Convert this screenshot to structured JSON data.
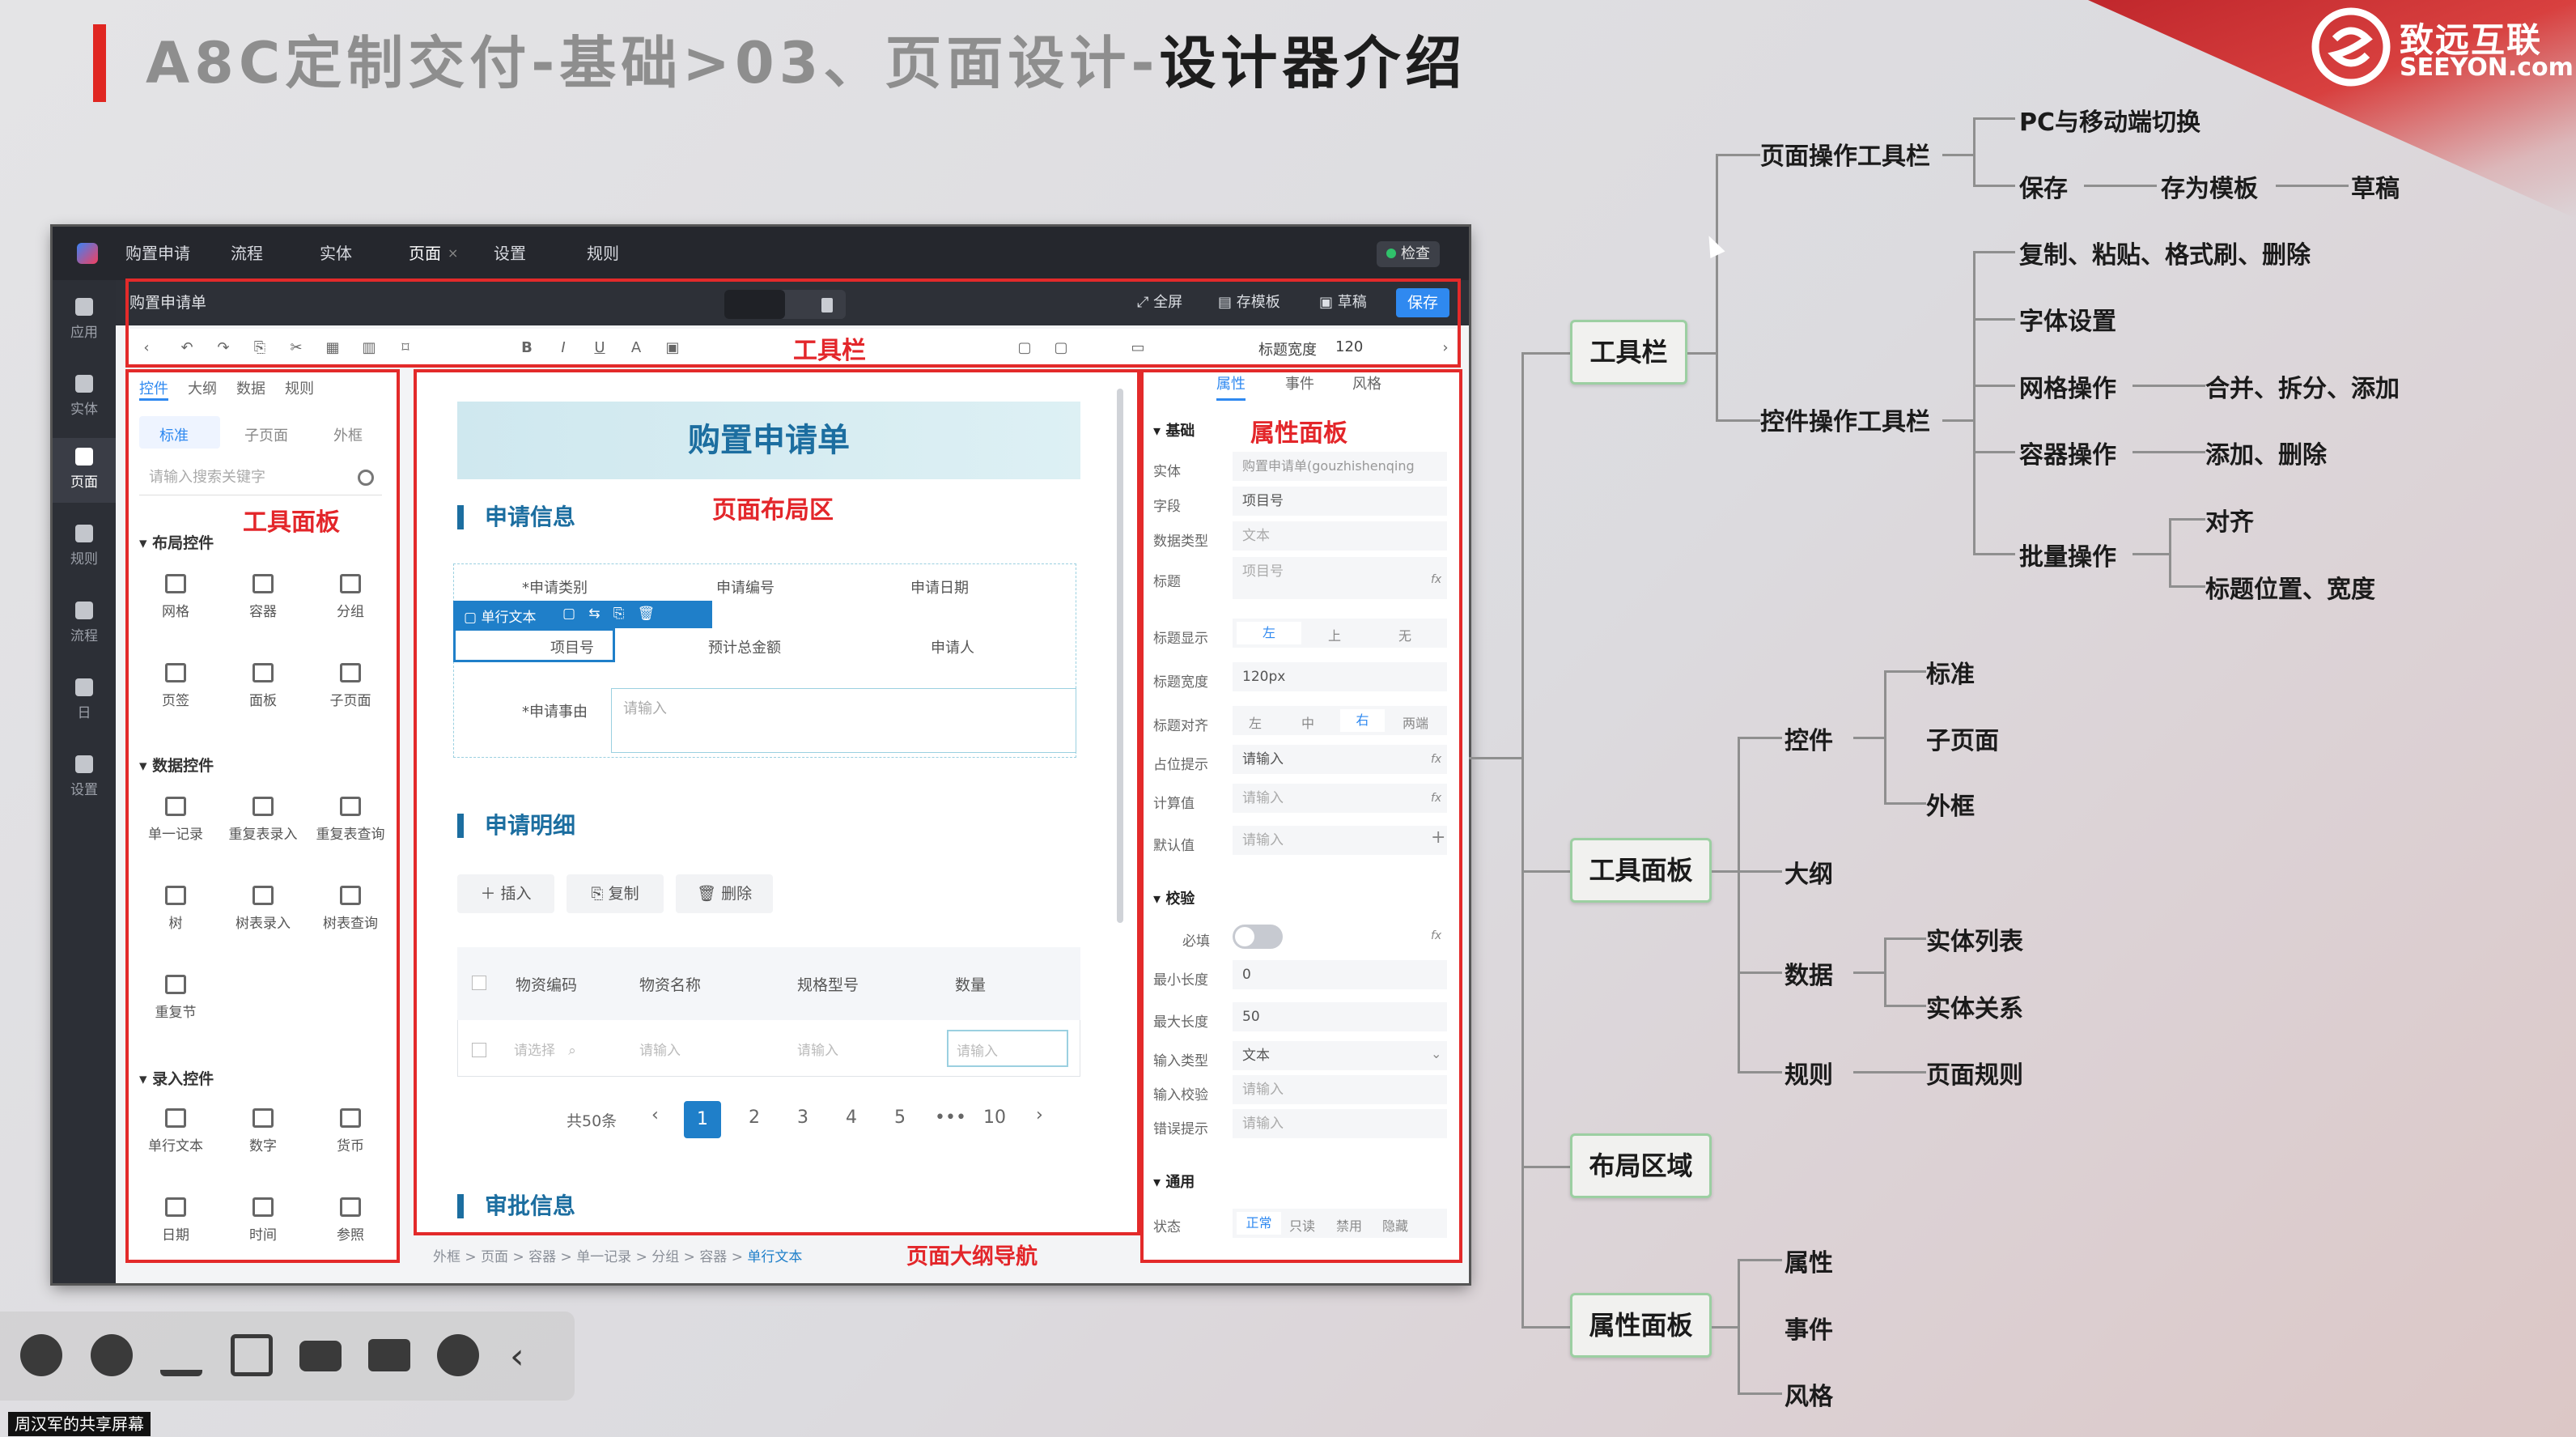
{
  "title": {
    "prefix": "A8C定制交付-基础>03、页面设计-",
    "emphasis": "设计器介绍"
  },
  "logo": {
    "name": "致远互联",
    "sub": "SEEYON.com"
  },
  "app": {
    "tabs": [
      "购置申请",
      "流程",
      "实体",
      "页面",
      "设置",
      "规则"
    ],
    "tab_close": "×",
    "check_label": "检查",
    "subtitle": "购置申请单",
    "actions": {
      "fullscreen": "全屏",
      "save_template": "存模板",
      "draft": "草稿",
      "save": "保存"
    },
    "title_width_label": "标题宽度",
    "title_width_value": "120",
    "sidebar": [
      {
        "label": "应用"
      },
      {
        "label": "实体"
      },
      {
        "label": "页面"
      },
      {
        "label": "规则"
      },
      {
        "label": "流程"
      },
      {
        "label": "日"
      },
      {
        "label": "设置"
      }
    ]
  },
  "annotations": {
    "toolbar": "工具栏",
    "tool_panel": "工具面板",
    "layout": "页面布局区",
    "props": "属性面板",
    "outline": "页面大纲导航"
  },
  "left_panel": {
    "tabs": [
      "控件",
      "大纲",
      "数据",
      "规则"
    ],
    "subtabs": [
      "标准",
      "子页面",
      "外框"
    ],
    "search_placeholder": "请输入搜索关键字",
    "groups": [
      {
        "title": "布局控件",
        "items": [
          "网格",
          "容器",
          "分组",
          "页签",
          "面板",
          "子页面"
        ]
      },
      {
        "title": "数据控件",
        "items": [
          "单一记录",
          "重复表录入",
          "重复表查询",
          "树",
          "树表录入",
          "树表查询",
          "重复节"
        ]
      },
      {
        "title": "录入控件",
        "items": [
          "单行文本",
          "数字",
          "货币",
          "日期",
          "时间",
          "参照"
        ]
      }
    ]
  },
  "canvas": {
    "form_title": "购置申请单",
    "sec1": "申请信息",
    "fields": {
      "type": "*申请类别",
      "no": "申请编号",
      "date": "申请日期",
      "item": "项目号",
      "budget": "预计总金额",
      "applicant": "申请人",
      "reason": "*申请事由",
      "reason_ph": "请输入"
    },
    "selected_chip": "单行文本",
    "sec2": "申请明细",
    "btns": {
      "insert": "插入",
      "copy": "复制",
      "delete": "删除"
    },
    "columns": [
      "物资编码",
      "物资名称",
      "规格型号",
      "数量"
    ],
    "row_ph": [
      "请选择",
      "请输入",
      "请输入",
      "请输入"
    ],
    "pager": {
      "total": "共50条",
      "pages": [
        "1",
        "2",
        "3",
        "4",
        "5",
        "•••",
        "10"
      ],
      "prev": "‹",
      "next": "›"
    },
    "sec3": "审批信息",
    "breadcrumb": [
      "外框",
      "页面",
      "容器",
      "单一记录",
      "分组",
      "容器",
      "单行文本"
    ],
    "bc_sep": ">"
  },
  "right_panel": {
    "tabs": [
      "属性",
      "事件",
      "风格"
    ],
    "sec_basic": "基础",
    "rows": [
      {
        "label": "实体",
        "value": "购置申请单(gouzhishenqing"
      },
      {
        "label": "字段",
        "value": "项目号"
      },
      {
        "label": "数据类型",
        "value": "文本"
      },
      {
        "label": "标题",
        "value": "项目号"
      }
    ],
    "title_display": {
      "label": "标题显示",
      "opts": [
        "左",
        "上",
        "无"
      ]
    },
    "title_width": {
      "label": "标题宽度",
      "value": "120px"
    },
    "title_align": {
      "label": "标题对齐",
      "opts": [
        "左",
        "中",
        "右",
        "两端"
      ]
    },
    "placeholder": {
      "label": "占位提示",
      "value": "请输入"
    },
    "calc": {
      "label": "计算值",
      "value": "请输入"
    },
    "default": {
      "label": "默认值",
      "value": "请输入"
    },
    "sec_check": "校验",
    "required": "必填",
    "min_len": {
      "label": "最小长度",
      "value": "0"
    },
    "max_len": {
      "label": "最大长度",
      "value": "50"
    },
    "input_type": {
      "label": "输入类型",
      "value": "文本"
    },
    "input_check": {
      "label": "输入校验",
      "value": "请输入"
    },
    "error_tip": {
      "label": "错误提示",
      "value": "请输入"
    },
    "sec_common": "通用",
    "state": {
      "label": "状态",
      "opts": [
        "正常",
        "只读",
        "禁用",
        "隐藏"
      ]
    },
    "fx": "fx"
  },
  "mindmap": {
    "toolbar": "工具栏",
    "page_ops": "页面操作工具栏",
    "pc_mobile": "PC与移动端切换",
    "save": "保存",
    "save_tpl": "存为模板",
    "draft": "草稿",
    "ctrl_ops": "控件操作工具栏",
    "copy_paste": "复制、粘贴、格式刷、删除",
    "font": "字体设置",
    "grid_ops": "网格操作",
    "grid_sub": "合并、拆分、添加",
    "container_ops": "容器操作",
    "container_sub": "添加、删除",
    "batch": "批量操作",
    "align": "对齐",
    "title_pos": "标题位置、宽度",
    "tool_panel": "工具面板",
    "controls": "控件",
    "standard": "标准",
    "subpage": "子页面",
    "frame": "外框",
    "outline": "大纲",
    "data": "数据",
    "entity_list": "实体列表",
    "entity_rel": "实体关系",
    "rules": "规则",
    "page_rules": "页面规则",
    "layout_area": "布局区域",
    "prop_panel": "属性面板",
    "props": "属性",
    "events": "事件",
    "style": "风格"
  },
  "share_label": "周汉军的共享屏幕"
}
